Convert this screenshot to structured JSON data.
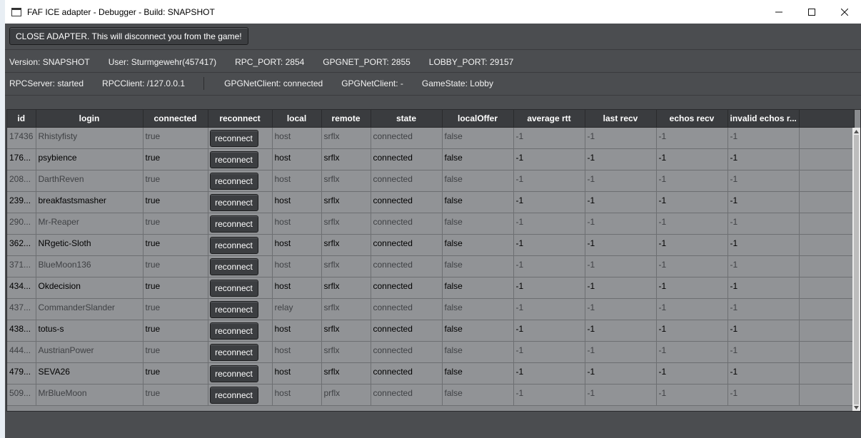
{
  "window": {
    "title": "FAF ICE adapter - Debugger - Build: SNAPSHOT",
    "minimize": "minimize",
    "maximize": "maximize",
    "close": "close"
  },
  "close_adapter_label": "CLOSE ADAPTER. This will disconnect you from the game!",
  "info1": {
    "version": "Version: SNAPSHOT",
    "user": "User: Sturmgewehr(457417)",
    "rpc_port": "RPC_PORT: 2854",
    "gpgnet_port": "GPGNET_PORT: 2855",
    "lobby_port": "LOBBY_PORT: 29157"
  },
  "info2": {
    "rpc_server": "RPCServer: started",
    "rpc_client": "RPCClient: /127.0.0.1",
    "gpgnet_client_1": "GPGNetClient: connected",
    "gpgnet_client_2": "GPGNetClient: -",
    "game_state": "GameState: Lobby"
  },
  "table": {
    "headers": [
      "id",
      "login",
      "connected",
      "reconnect",
      "local",
      "remote",
      "state",
      "localOffer",
      "average rtt",
      "last recv",
      "echos recv",
      "invalid echos r..."
    ],
    "reconnect_label": "reconnect",
    "rows": [
      {
        "id": "17436",
        "login": "Rhistyfisty",
        "connected": "true",
        "local": "host",
        "remote": "srflx",
        "state": "connected",
        "localOffer": "false",
        "rtt": "-1",
        "last_recv": "-1",
        "echos": "-1",
        "invalid": "-1",
        "style": "dim"
      },
      {
        "id": "176...",
        "login": "psybience",
        "connected": "true",
        "local": "host",
        "remote": "srflx",
        "state": "connected",
        "localOffer": "false",
        "rtt": "-1",
        "last_recv": "-1",
        "echos": "-1",
        "invalid": "-1",
        "style": "bold"
      },
      {
        "id": "208...",
        "login": "DarthReven",
        "connected": "true",
        "local": "host",
        "remote": "srflx",
        "state": "connected",
        "localOffer": "false",
        "rtt": "-1",
        "last_recv": "-1",
        "echos": "-1",
        "invalid": "-1",
        "style": "dim"
      },
      {
        "id": "239...",
        "login": "breakfastsmasher",
        "connected": "true",
        "local": "host",
        "remote": "srflx",
        "state": "connected",
        "localOffer": "false",
        "rtt": "-1",
        "last_recv": "-1",
        "echos": "-1",
        "invalid": "-1",
        "style": "bold"
      },
      {
        "id": "290...",
        "login": "Mr-Reaper",
        "connected": "true",
        "local": "host",
        "remote": "srflx",
        "state": "connected",
        "localOffer": "false",
        "rtt": "-1",
        "last_recv": "-1",
        "echos": "-1",
        "invalid": "-1",
        "style": "dim"
      },
      {
        "id": "362...",
        "login": "NRgetic-Sloth",
        "connected": "true",
        "local": "host",
        "remote": "srflx",
        "state": "connected",
        "localOffer": "false",
        "rtt": "-1",
        "last_recv": "-1",
        "echos": "-1",
        "invalid": "-1",
        "style": "bold"
      },
      {
        "id": "371...",
        "login": "BlueMoon136",
        "connected": "true",
        "local": "host",
        "remote": "srflx",
        "state": "connected",
        "localOffer": "false",
        "rtt": "-1",
        "last_recv": "-1",
        "echos": "-1",
        "invalid": "-1",
        "style": "dim"
      },
      {
        "id": "434...",
        "login": "Okdecision",
        "connected": "true",
        "local": "host",
        "remote": "srflx",
        "state": "connected",
        "localOffer": "false",
        "rtt": "-1",
        "last_recv": "-1",
        "echos": "-1",
        "invalid": "-1",
        "style": "bold"
      },
      {
        "id": "437...",
        "login": "CommanderSlander",
        "connected": "true",
        "local": "relay",
        "remote": "srflx",
        "state": "connected",
        "localOffer": "false",
        "rtt": "-1",
        "last_recv": "-1",
        "echos": "-1",
        "invalid": "-1",
        "style": "dim"
      },
      {
        "id": "438...",
        "login": "totus-s",
        "connected": "true",
        "local": "host",
        "remote": "srflx",
        "state": "connected",
        "localOffer": "false",
        "rtt": "-1",
        "last_recv": "-1",
        "echos": "-1",
        "invalid": "-1",
        "style": "bold"
      },
      {
        "id": "444...",
        "login": "AustrianPower",
        "connected": "true",
        "local": "host",
        "remote": "srflx",
        "state": "connected",
        "localOffer": "false",
        "rtt": "-1",
        "last_recv": "-1",
        "echos": "-1",
        "invalid": "-1",
        "style": "dim"
      },
      {
        "id": "479...",
        "login": "SEVA26",
        "connected": "true",
        "local": "host",
        "remote": "srflx",
        "state": "connected",
        "localOffer": "false",
        "rtt": "-1",
        "last_recv": "-1",
        "echos": "-1",
        "invalid": "-1",
        "style": "bold"
      },
      {
        "id": "509...",
        "login": "MrBlueMoon",
        "connected": "true",
        "local": "host",
        "remote": "prflx",
        "state": "connected",
        "localOffer": "false",
        "rtt": "-1",
        "last_recv": "-1",
        "echos": "-1",
        "invalid": "-1",
        "style": "dim"
      }
    ]
  },
  "colors": {
    "window_bg": "#4b4d50",
    "table_bg": "#919396",
    "button_bg": "#3c3e41",
    "desktop_bg": "#0a6fb8"
  }
}
